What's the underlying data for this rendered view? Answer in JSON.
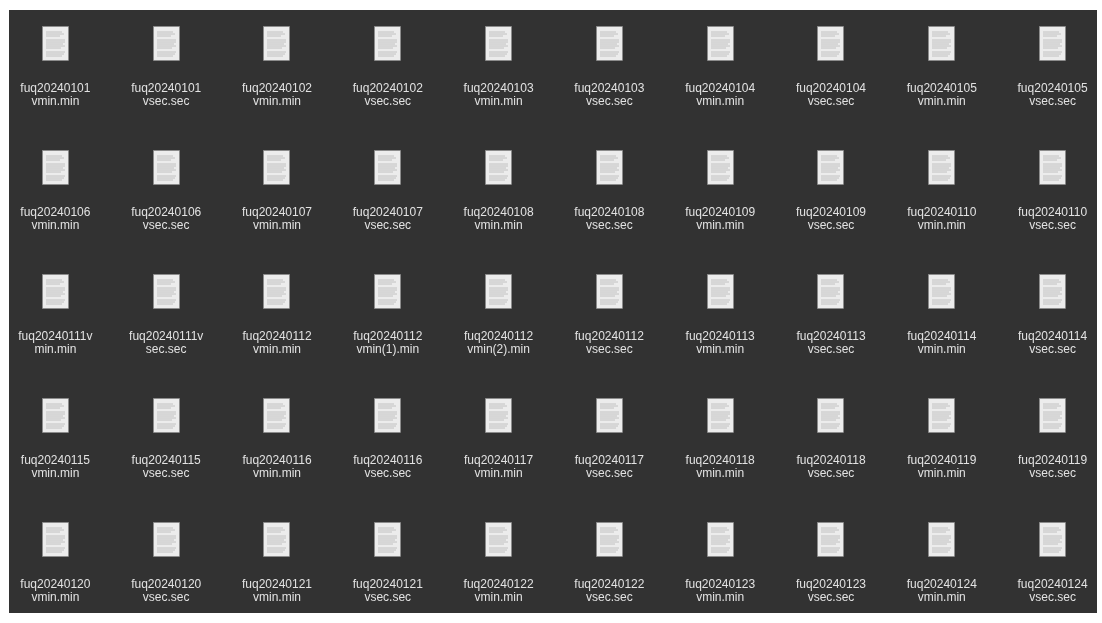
{
  "files": [
    {
      "name": "fuq20240101\nvmin.min"
    },
    {
      "name": "fuq20240101\nvsec.sec"
    },
    {
      "name": "fuq20240102\nvmin.min"
    },
    {
      "name": "fuq20240102\nvsec.sec"
    },
    {
      "name": "fuq20240103\nvmin.min"
    },
    {
      "name": "fuq20240103\nvsec.sec"
    },
    {
      "name": "fuq20240104\nvmin.min"
    },
    {
      "name": "fuq20240104\nvsec.sec"
    },
    {
      "name": "fuq20240105\nvmin.min"
    },
    {
      "name": "fuq20240105\nvsec.sec"
    },
    {
      "name": "fuq20240106\nvmin.min"
    },
    {
      "name": "fuq20240106\nvsec.sec"
    },
    {
      "name": "fuq20240107\nvmin.min"
    },
    {
      "name": "fuq20240107\nvsec.sec"
    },
    {
      "name": "fuq20240108\nvmin.min"
    },
    {
      "name": "fuq20240108\nvsec.sec"
    },
    {
      "name": "fuq20240109\nvmin.min"
    },
    {
      "name": "fuq20240109\nvsec.sec"
    },
    {
      "name": "fuq20240110\nvmin.min"
    },
    {
      "name": "fuq20240110\nvsec.sec"
    },
    {
      "name": "fuq20240111v\nmin.min"
    },
    {
      "name": "fuq20240111v\nsec.sec"
    },
    {
      "name": "fuq20240112\nvmin.min"
    },
    {
      "name": "fuq20240112\nvmin(1).min"
    },
    {
      "name": "fuq20240112\nvmin(2).min"
    },
    {
      "name": "fuq20240112\nvsec.sec"
    },
    {
      "name": "fuq20240113\nvmin.min"
    },
    {
      "name": "fuq20240113\nvsec.sec"
    },
    {
      "name": "fuq20240114\nvmin.min"
    },
    {
      "name": "fuq20240114\nvsec.sec"
    },
    {
      "name": "fuq20240115\nvmin.min"
    },
    {
      "name": "fuq20240115\nvsec.sec"
    },
    {
      "name": "fuq20240116\nvmin.min"
    },
    {
      "name": "fuq20240116\nvsec.sec"
    },
    {
      "name": "fuq20240117\nvmin.min"
    },
    {
      "name": "fuq20240117\nvsec.sec"
    },
    {
      "name": "fuq20240118\nvmin.min"
    },
    {
      "name": "fuq20240118\nvsec.sec"
    },
    {
      "name": "fuq20240119\nvmin.min"
    },
    {
      "name": "fuq20240119\nvsec.sec"
    },
    {
      "name": "fuq20240120\nvmin.min"
    },
    {
      "name": "fuq20240120\nvsec.sec"
    },
    {
      "name": "fuq20240121\nvmin.min"
    },
    {
      "name": "fuq20240121\nvsec.sec"
    },
    {
      "name": "fuq20240122\nvmin.min"
    },
    {
      "name": "fuq20240122\nvsec.sec"
    },
    {
      "name": "fuq20240123\nvmin.min"
    },
    {
      "name": "fuq20240123\nvsec.sec"
    },
    {
      "name": "fuq20240124\nvmin.min"
    },
    {
      "name": "fuq20240124\nvsec.sec"
    }
  ]
}
